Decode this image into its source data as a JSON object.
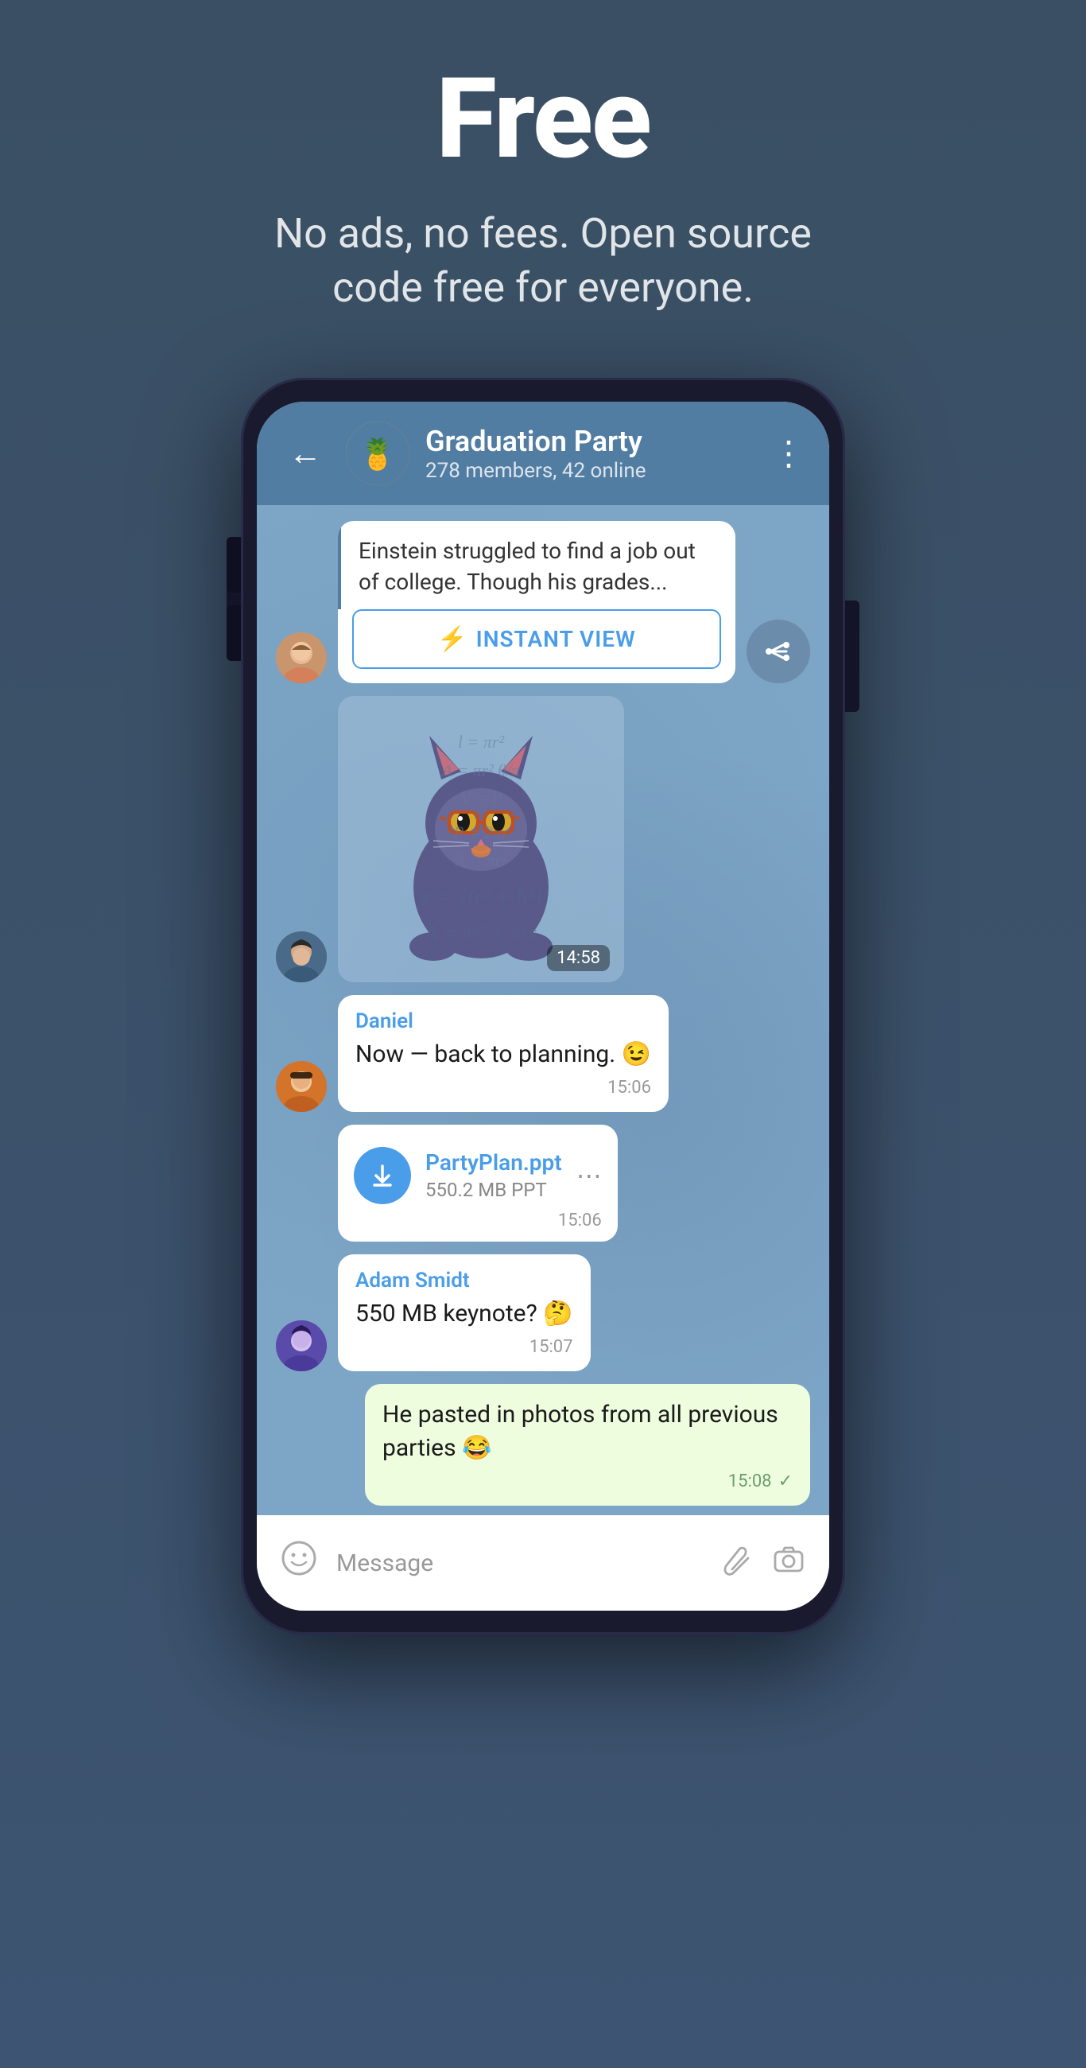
{
  "hero": {
    "title": "Free",
    "subtitle": "No ads, no fees. Open source code free for everyone."
  },
  "app_bar": {
    "group_name": "Graduation Party",
    "group_status": "278 members, 42 online",
    "back_label": "←",
    "menu_label": "⋮",
    "avatar_emoji": "🍍"
  },
  "messages": [
    {
      "id": "link_preview",
      "type": "link_preview",
      "sender_avatar": "girl",
      "text": "Einstein struggled to find a job out of college. Though his grades...",
      "instant_view_label": "INSTANT VIEW"
    },
    {
      "id": "sticker",
      "type": "sticker",
      "sender_avatar": "guy1",
      "time": "14:58"
    },
    {
      "id": "msg_daniel",
      "type": "text",
      "sender": "Daniel",
      "sender_avatar": "guy2",
      "text": "Now — back to planning. 😉",
      "time": "15:06"
    },
    {
      "id": "msg_file",
      "type": "file",
      "sender_avatar": "guy2",
      "file_name": "PartyPlan.ppt",
      "file_size": "550.2 MB PPT",
      "time": "15:06"
    },
    {
      "id": "msg_adam",
      "type": "text",
      "sender": "Adam Smidt",
      "sender_avatar": "guy3",
      "text": "550 MB keynote? 🤔",
      "time": "15:07"
    },
    {
      "id": "msg_sent",
      "type": "sent",
      "text": "He pasted in photos from all previous parties 😂",
      "time": "15:08",
      "check": "✓"
    }
  ],
  "bottom_bar": {
    "placeholder": "Message",
    "emoji_icon": "emoji-icon",
    "attachment_icon": "attachment-icon",
    "camera_icon": "camera-icon"
  },
  "colors": {
    "accent": "#4a9de8",
    "sender_name": "#4a9de8",
    "app_bar": "#527da3",
    "sent_bubble": "#effddf",
    "check_color": "#6c9e6c"
  }
}
